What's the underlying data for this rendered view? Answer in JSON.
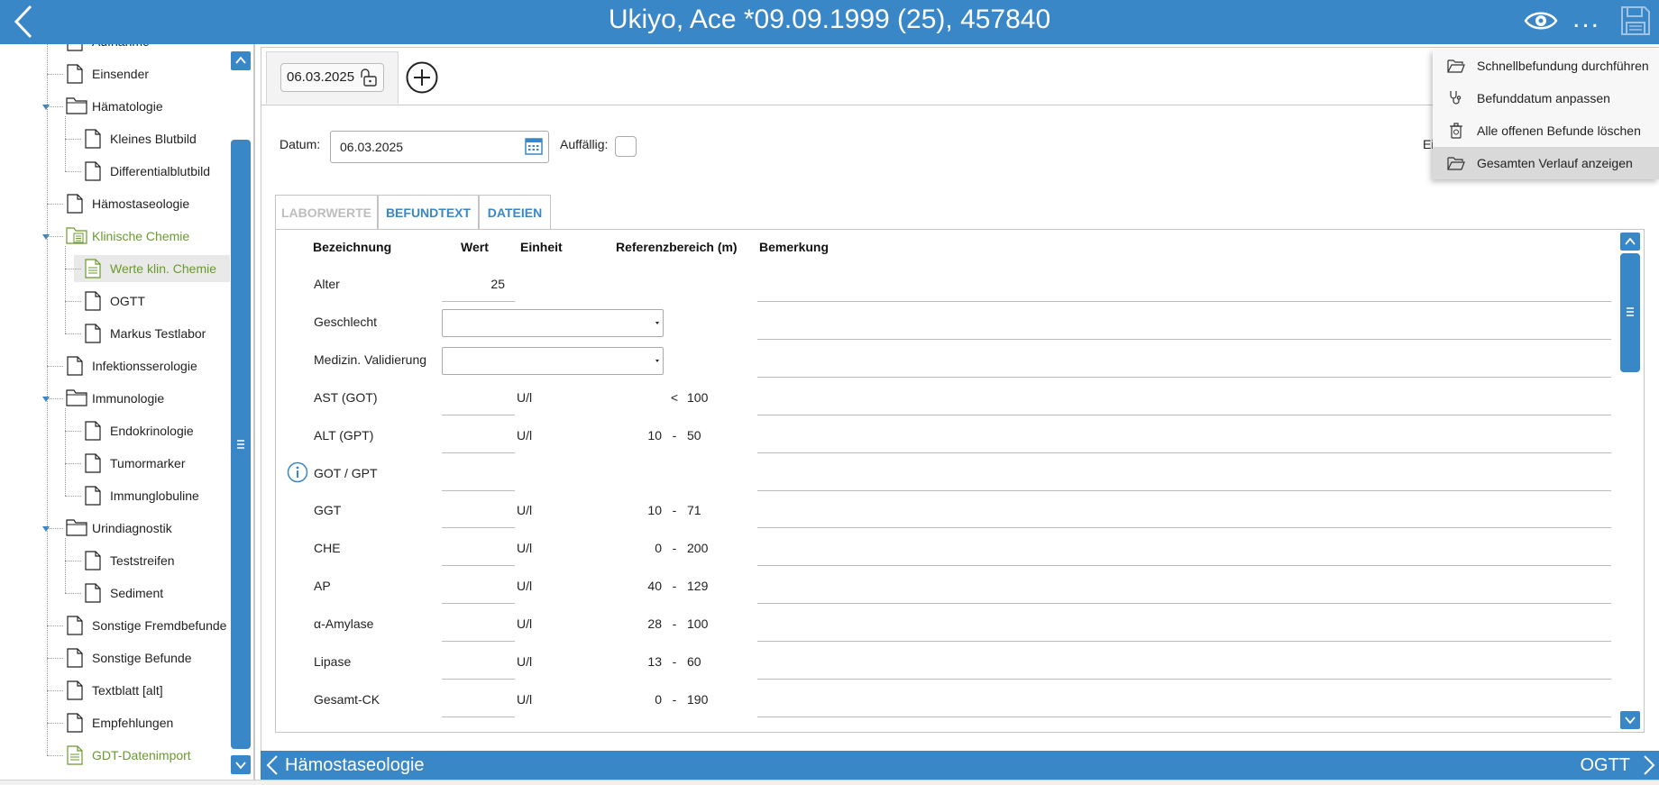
{
  "header": {
    "title": "Ukiyo, Ace *09.09.1999 (25), 457840",
    "more_label": "..."
  },
  "tree": {
    "items": [
      {
        "label": "Aufnahme",
        "icon": "document-icon",
        "level": 1
      },
      {
        "label": "Einsender",
        "icon": "document-icon",
        "level": 1
      },
      {
        "label": "Hämatologie",
        "icon": "folder-icon",
        "level": 1
      },
      {
        "label": "Kleines Blutbild",
        "icon": "document-icon",
        "level": 2
      },
      {
        "label": "Differentialblutbild",
        "icon": "document-icon",
        "level": 2
      },
      {
        "label": "Hämostaseologie",
        "icon": "document-icon",
        "level": 1
      },
      {
        "label": "Klinische Chemie",
        "icon": "folder-doc-icon",
        "level": 1
      },
      {
        "label": "Werte klin. Chemie",
        "icon": "document-lines-icon",
        "level": 2
      },
      {
        "label": "OGTT",
        "icon": "document-icon",
        "level": 2
      },
      {
        "label": "Markus Testlabor",
        "icon": "document-icon",
        "level": 2
      },
      {
        "label": "Infektionsserologie",
        "icon": "document-icon",
        "level": 1
      },
      {
        "label": "Immunologie",
        "icon": "folder-icon",
        "level": 1
      },
      {
        "label": "Endokrinologie",
        "icon": "document-icon",
        "level": 2
      },
      {
        "label": "Tumormarker",
        "icon": "document-icon",
        "level": 2
      },
      {
        "label": "Immunglobuline",
        "icon": "document-icon",
        "level": 2
      },
      {
        "label": "Urindiagnostik",
        "icon": "folder-icon",
        "level": 1
      },
      {
        "label": "Teststreifen",
        "icon": "document-icon",
        "level": 2
      },
      {
        "label": "Sediment",
        "icon": "document-icon",
        "level": 2
      },
      {
        "label": "Sonstige Fremdbefunde",
        "icon": "document-icon",
        "level": 1
      },
      {
        "label": "Sonstige Befunde",
        "icon": "document-icon",
        "level": 1
      },
      {
        "label": "Textblatt [alt]",
        "icon": "document-icon",
        "level": 1
      },
      {
        "label": "Empfehlungen",
        "icon": "document-icon",
        "level": 1
      },
      {
        "label": "GDT-Datenimport",
        "icon": "document-lines-icon",
        "level": 1
      }
    ]
  },
  "date_tab": {
    "label": "06.03.2025"
  },
  "form": {
    "datum_label": "Datum:",
    "datum_value": "06.03.2025",
    "auffaellig_label": "Auffällig:",
    "ei_label": "Ei"
  },
  "tabs": [
    {
      "label": "LABORWERTE",
      "active": true
    },
    {
      "label": "BEFUNDTEXT",
      "active": false
    },
    {
      "label": "DATEIEN",
      "active": false
    }
  ],
  "table": {
    "headers": {
      "bezeichnung": "Bezeichnung",
      "wert": "Wert",
      "einheit": "Einheit",
      "referenz": "Referenzbereich (m)",
      "bemerkung": "Bemerkung"
    },
    "rows": [
      {
        "label": "Alter",
        "value": "25",
        "unit": "",
        "lo": "",
        "sep": "",
        "hi": "",
        "type": "text"
      },
      {
        "label": "Geschlecht",
        "value": "",
        "unit": "",
        "lo": "",
        "sep": "",
        "hi": "",
        "type": "select"
      },
      {
        "label": "Medizin. Validierung",
        "value": "",
        "unit": "",
        "lo": "",
        "sep": "",
        "hi": "",
        "type": "select"
      },
      {
        "label": "AST (GOT)",
        "value": "",
        "unit": "U/l",
        "lo": "",
        "sep": "<",
        "hi": "100",
        "type": "text"
      },
      {
        "label": "ALT (GPT)",
        "value": "",
        "unit": "U/l",
        "lo": "10",
        "sep": "-",
        "hi": "50",
        "type": "text"
      },
      {
        "label": "GOT / GPT",
        "value": "",
        "unit": "",
        "lo": "",
        "sep": "",
        "hi": "",
        "type": "text",
        "info": true
      },
      {
        "label": "GGT",
        "value": "",
        "unit": "U/l",
        "lo": "10",
        "sep": "-",
        "hi": "71",
        "type": "text"
      },
      {
        "label": "CHE",
        "value": "",
        "unit": "U/l",
        "lo": "0",
        "sep": "-",
        "hi": "200",
        "type": "text"
      },
      {
        "label": "AP",
        "value": "",
        "unit": "U/l",
        "lo": "40",
        "sep": "-",
        "hi": "129",
        "type": "text"
      },
      {
        "label": "α-Amylase",
        "value": "",
        "unit": "U/l",
        "lo": "28",
        "sep": "-",
        "hi": "100",
        "type": "text"
      },
      {
        "label": "Lipase",
        "value": "",
        "unit": "U/l",
        "lo": "13",
        "sep": "-",
        "hi": "60",
        "type": "text"
      },
      {
        "label": "Gesamt-CK",
        "value": "",
        "unit": "U/l",
        "lo": "0",
        "sep": "-",
        "hi": "190",
        "type": "text"
      }
    ]
  },
  "bottom": {
    "prev_label": "Hämostaseologie",
    "next_label": "OGTT"
  },
  "context_menu": {
    "items": [
      {
        "label": "Schnellbefundung durchführen",
        "icon": "folder-open-icon"
      },
      {
        "label": "Befunddatum anpassen",
        "icon": "stethoscope-icon"
      },
      {
        "label": "Alle offenen Befunde löschen",
        "icon": "trash-icon"
      },
      {
        "label": "Gesamten Verlauf anzeigen",
        "icon": "folder-open-icon",
        "hover": true
      }
    ]
  },
  "colors": {
    "accent": "#3a87c7",
    "green": "#6a9a2d"
  }
}
